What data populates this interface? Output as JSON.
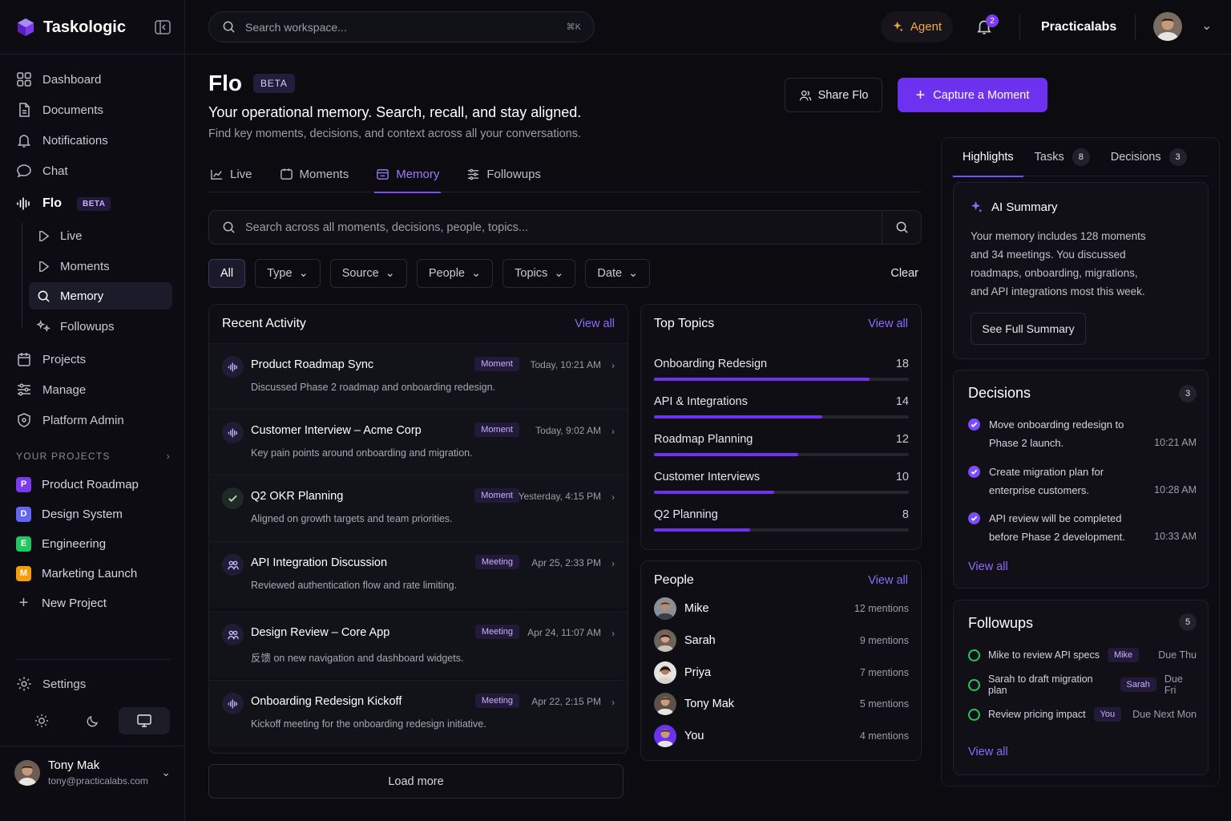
{
  "app": {
    "name": "Taskologic"
  },
  "nav": [
    {
      "label": "Dashboard",
      "icon": "grid-icon"
    },
    {
      "label": "Documents",
      "icon": "document-icon"
    },
    {
      "label": "Notifications",
      "icon": "bell-icon"
    },
    {
      "label": "Chat",
      "icon": "chat-icon"
    },
    {
      "label": "Flo",
      "icon": "waveform-icon",
      "badge": "BETA"
    },
    {
      "label": "Projects",
      "icon": "clipboard-icon"
    },
    {
      "label": "Manage",
      "icon": "sliders-icon"
    },
    {
      "label": "Platform Admin",
      "icon": "shield-icon"
    }
  ],
  "flo_sub": [
    {
      "label": "Live",
      "icon": "play-icon"
    },
    {
      "label": "Moments",
      "icon": "play-icon"
    },
    {
      "label": "Memory",
      "icon": "search-icon",
      "active": true
    },
    {
      "label": "Followups",
      "icon": "sparkle-icon"
    }
  ],
  "projects": {
    "header": "YOUR PROJECTS",
    "items": [
      {
        "letter": "P",
        "label": "Product Roadmap",
        "color": "#7c3aed"
      },
      {
        "letter": "D",
        "label": "Design System",
        "color": "#6366f1"
      },
      {
        "letter": "E",
        "label": "Engineering",
        "color": "#22c55e"
      },
      {
        "letter": "M",
        "label": "Marketing Launch",
        "color": "#f59e0b"
      }
    ],
    "new_label": "New Project"
  },
  "settings_label": "Settings",
  "user": {
    "name": "Tony Mak",
    "email": "tony@practicalabs.com"
  },
  "topbar": {
    "search_placeholder": "Search workspace...",
    "shortcut": "⌘K",
    "agent_label": "Agent",
    "notif_count": "2",
    "org": "Practicalabs"
  },
  "page": {
    "title": "Flo",
    "badge": "BETA",
    "subtitle": "Your operational memory. Search, recall, and stay aligned.",
    "description": "Find key moments, decisions, and context across all your conversations.",
    "share_label": "Share Flo",
    "capture_label": "Capture a Moment"
  },
  "tabs": [
    {
      "label": "Live",
      "icon": "live-icon"
    },
    {
      "label": "Moments",
      "icon": "moments-icon"
    },
    {
      "label": "Memory",
      "icon": "memory-icon",
      "active": true
    },
    {
      "label": "Followups",
      "icon": "followups-icon"
    }
  ],
  "memory_search": {
    "placeholder": "Search across all moments, decisions, people, topics..."
  },
  "filters": [
    "All",
    "Type",
    "Source",
    "People",
    "Topics",
    "Date"
  ],
  "clear_label": "Clear",
  "recent": {
    "title": "Recent Activity",
    "view_all": "View all",
    "items": [
      {
        "title": "Product Roadmap Sync",
        "desc": "Discussed Phase 2 roadmap and onboarding redesign.",
        "tag": "Moment",
        "time": "Today, 10:21 AM",
        "icon": "waveform-icon"
      },
      {
        "title": "Customer Interview – Acme Corp",
        "desc": "Key pain points around onboarding and migration.",
        "tag": "Moment",
        "time": "Today, 9:02 AM",
        "icon": "waveform-icon"
      },
      {
        "title": "Q2 OKR Planning",
        "desc": "Aligned on growth targets and team priorities.",
        "tag": "Moment",
        "time": "Yesterday, 4:15 PM",
        "icon": "check-icon"
      },
      {
        "title": "API Integration Discussion",
        "desc": "Reviewed authentication flow and rate limiting.",
        "tag": "Meeting",
        "time": "Apr 25, 2:33 PM",
        "icon": "meeting-icon"
      },
      {
        "title": "Design Review – Core App",
        "desc": "反馈 on new navigation and dashboard widgets.",
        "tag": "Meeting",
        "time": "Apr 24, 11:07 AM",
        "icon": "meeting-icon"
      },
      {
        "title": "Onboarding Redesign Kickoff",
        "desc": "Kickoff meeting for the onboarding redesign initiative.",
        "tag": "Meeting",
        "time": "Apr 22, 2:15 PM",
        "icon": "waveform-icon"
      }
    ],
    "load_more": "Load more"
  },
  "topics": {
    "title": "Top Topics",
    "view_all": "View all",
    "items": [
      {
        "label": "Onboarding Redesign",
        "count": 18
      },
      {
        "label": "API & Integrations",
        "count": 14
      },
      {
        "label": "Roadmap Planning",
        "count": 12
      },
      {
        "label": "Customer Interviews",
        "count": 10
      },
      {
        "label": "Q2 Planning",
        "count": 8
      }
    ]
  },
  "people": {
    "title": "People",
    "view_all": "View all",
    "items": [
      {
        "name": "Mike",
        "mentions": "12 mentions"
      },
      {
        "name": "Sarah",
        "mentions": "9 mentions"
      },
      {
        "name": "Priya",
        "mentions": "7 mentions"
      },
      {
        "name": "Tony Mak",
        "mentions": "5 mentions"
      },
      {
        "name": "You",
        "mentions": "4 mentions"
      }
    ]
  },
  "right_tabs": [
    {
      "label": "Highlights",
      "active": true
    },
    {
      "label": "Tasks",
      "count": "8"
    },
    {
      "label": "Decisions",
      "count": "3"
    }
  ],
  "ai_summary": {
    "title": "AI Summary",
    "lines": [
      "Your memory includes 128 moments",
      "and 34 meetings. You discussed",
      "roadmaps, onboarding, migrations,",
      "and API integrations most this week."
    ],
    "button": "See Full Summary"
  },
  "decisions": {
    "title": "Decisions",
    "count": "3",
    "items": [
      {
        "line1": "Move onboarding redesign to",
        "line2": "Phase 2 launch.",
        "time": "10:21 AM"
      },
      {
        "line1": "Create migration plan for",
        "line2": "enterprise customers.",
        "time": "10:28 AM"
      },
      {
        "line1": "API review will be completed",
        "line2": "before Phase 2 development.",
        "time": "10:33 AM"
      }
    ],
    "view_all": "View all"
  },
  "followups": {
    "title": "Followups",
    "count": "5",
    "items": [
      {
        "text": "Mike to review API specs",
        "who": "Mike",
        "due": "Due Thu"
      },
      {
        "text": "Sarah to draft migration plan",
        "who": "Sarah",
        "due": "Due Fri"
      },
      {
        "text": "Review pricing impact",
        "who": "You",
        "due": "Due Next Mon"
      }
    ],
    "view_all": "View all"
  }
}
